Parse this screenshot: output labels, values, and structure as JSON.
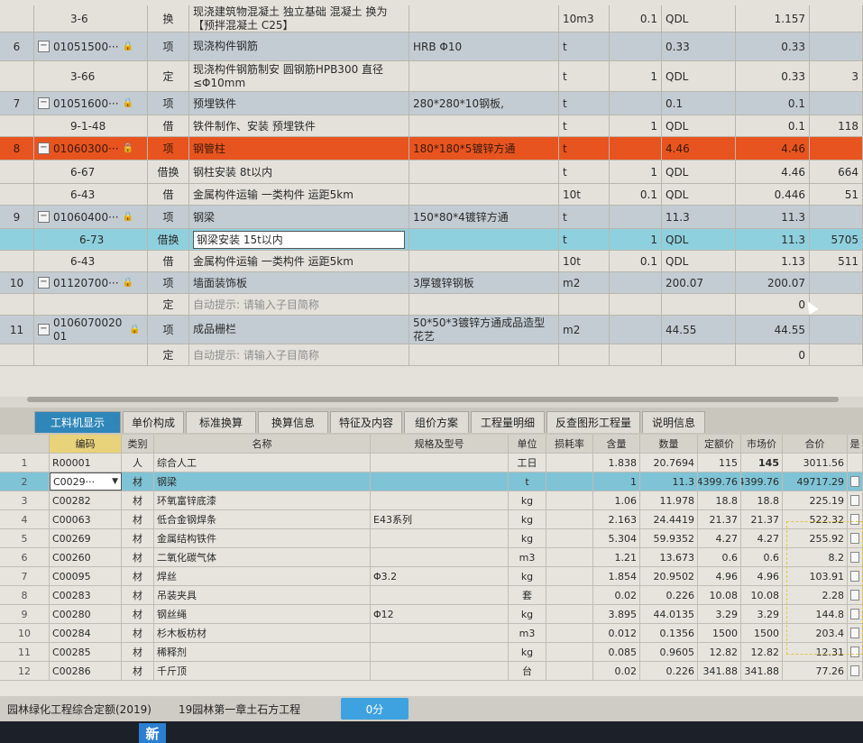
{
  "upper_grid": {
    "rows": [
      {
        "type": "sub",
        "num": "",
        "code": "3-6",
        "kind": "换",
        "name": "现浇建筑物混凝土 独立基础 混凝土 换为【预拌混凝土 C25】",
        "spec": "",
        "unit": "10m3",
        "qty_factor": "0.1",
        "qty": "QDL",
        "price": "",
        "total": "1.157",
        "extra": ""
      },
      {
        "type": "head",
        "num": "6",
        "code": "01051500···",
        "kind": "项",
        "name": "现浇构件钢筋",
        "spec": "HRB Φ10",
        "unit": "t",
        "qty_factor": "",
        "qty": "0.33",
        "price": "",
        "total": "0.33",
        "extra": ""
      },
      {
        "type": "sub",
        "num": "",
        "code": "3-66",
        "kind": "定",
        "name": "现浇构件钢筋制安 圆钢筋HPB300 直径≤Φ10mm",
        "spec": "",
        "unit": "t",
        "qty_factor": "1",
        "qty": "QDL",
        "price": "",
        "total": "0.33",
        "extra": "3"
      },
      {
        "type": "head",
        "num": "7",
        "code": "01051600···",
        "kind": "项",
        "name": "预埋铁件",
        "spec": "280*280*10钢板,",
        "unit": "t",
        "qty_factor": "",
        "qty": "0.1",
        "price": "",
        "total": "0.1",
        "extra": ""
      },
      {
        "type": "sub",
        "num": "",
        "code": "9-1-48",
        "kind": "借",
        "name": "铁件制作、安装 预埋铁件",
        "spec": "",
        "unit": "t",
        "qty_factor": "1",
        "qty": "QDL",
        "price": "",
        "total": "0.1",
        "extra": "118"
      },
      {
        "type": "sel",
        "num": "8",
        "code": "01060300···",
        "kind": "项",
        "name": "钢管柱",
        "spec": "180*180*5镀锌方通",
        "unit": "t",
        "qty_factor": "",
        "qty": "4.46",
        "price": "",
        "total": "4.46",
        "extra": ""
      },
      {
        "type": "sub",
        "num": "",
        "code": "6-67",
        "kind": "借换",
        "name": "钢柱安装 8t以内",
        "spec": "",
        "unit": "t",
        "qty_factor": "1",
        "qty": "QDL",
        "price": "",
        "total": "4.46",
        "extra": "664"
      },
      {
        "type": "sub",
        "num": "",
        "code": "6-43",
        "kind": "借",
        "name": "金属构件运输 一类构件 运距5km",
        "spec": "",
        "unit": "10t",
        "qty_factor": "0.1",
        "qty": "QDL",
        "price": "",
        "total": "0.446",
        "extra": "51"
      },
      {
        "type": "head",
        "num": "9",
        "code": "01060400···",
        "kind": "项",
        "name": "钢梁",
        "spec": "150*80*4镀锌方通",
        "unit": "t",
        "qty_factor": "",
        "qty": "11.3",
        "price": "",
        "total": "11.3",
        "extra": ""
      },
      {
        "type": "cur",
        "num": "",
        "code": "6-73",
        "kind": "借换",
        "name": "钢梁安装 15t以内",
        "spec": "",
        "unit": "t",
        "qty_factor": "1",
        "qty": "QDL",
        "price": "",
        "total": "11.3",
        "extra": "5705"
      },
      {
        "type": "sub",
        "num": "",
        "code": "6-43",
        "kind": "借",
        "name": "金属构件运输 一类构件 运距5km",
        "spec": "",
        "unit": "10t",
        "qty_factor": "0.1",
        "qty": "QDL",
        "price": "",
        "total": "1.13",
        "extra": "511"
      },
      {
        "type": "head",
        "num": "10",
        "code": "01120700···",
        "kind": "项",
        "name": "墙面装饰板",
        "spec": "3厚镀锌钢板",
        "unit": "m2",
        "qty_factor": "",
        "qty": "200.07",
        "price": "",
        "total": "200.07",
        "extra": ""
      },
      {
        "type": "sub",
        "num": "",
        "code": "",
        "kind": "定",
        "name": "自动提示: 请输入子目简称",
        "spec": "",
        "unit": "",
        "qty_factor": "",
        "qty": "",
        "price": "",
        "total": "0",
        "extra": "",
        "hint": true
      },
      {
        "type": "head",
        "num": "11",
        "code": "0106070020 01",
        "kind": "项",
        "name": "成品栅栏",
        "spec": "50*50*3镀锌方通成品造型花艺",
        "unit": "m2",
        "qty_factor": "",
        "qty": "44.55",
        "price": "",
        "total": "44.55",
        "extra": ""
      },
      {
        "type": "sub",
        "num": "",
        "code": "",
        "kind": "定",
        "name": "自动提示: 请输入子目简称",
        "spec": "",
        "unit": "",
        "qty_factor": "",
        "qty": "",
        "price": "",
        "total": "0",
        "extra": "",
        "hint": true
      }
    ]
  },
  "tabs": [
    "工料机显示",
    "单价构成",
    "标准换算",
    "换算信息",
    "特征及内容",
    "组价方案",
    "工程量明细",
    "反查图形工程量",
    "说明信息"
  ],
  "lower_grid": {
    "headers": [
      "",
      "编码",
      "类别",
      "名称",
      "规格及型号",
      "单位",
      "损耗率",
      "含量",
      "数量",
      "定额价",
      "市场价",
      "合价",
      "是"
    ],
    "rows": [
      {
        "n": "1",
        "code": "R00001",
        "cat": "人",
        "name": "综合人工",
        "spec": "",
        "unit": "工日",
        "loss": "",
        "content": "1.838",
        "qty": "20.7694",
        "quota": "115",
        "market": "145",
        "total": "3011.56"
      },
      {
        "n": "2",
        "code": "C0029···",
        "cat": "材",
        "name": "钢梁",
        "spec": "",
        "unit": "t",
        "loss": "",
        "content": "1",
        "qty": "11.3",
        "quota": "4399.76",
        "market": "4399.76",
        "total": "49717.29"
      },
      {
        "n": "3",
        "code": "C00282",
        "cat": "材",
        "name": "环氧富锌底漆",
        "spec": "",
        "unit": "kg",
        "loss": "",
        "content": "1.06",
        "qty": "11.978",
        "quota": "18.8",
        "market": "18.8",
        "total": "225.19"
      },
      {
        "n": "4",
        "code": "C00063",
        "cat": "材",
        "name": "低合金钢焊条",
        "spec": "E43系列",
        "unit": "kg",
        "loss": "",
        "content": "2.163",
        "qty": "24.4419",
        "quota": "21.37",
        "market": "21.37",
        "total": "522.32"
      },
      {
        "n": "5",
        "code": "C00269",
        "cat": "材",
        "name": "金属结构铁件",
        "spec": "",
        "unit": "kg",
        "loss": "",
        "content": "5.304",
        "qty": "59.9352",
        "quota": "4.27",
        "market": "4.27",
        "total": "255.92"
      },
      {
        "n": "6",
        "code": "C00260",
        "cat": "材",
        "name": "二氧化碳气体",
        "spec": "",
        "unit": "m3",
        "loss": "",
        "content": "1.21",
        "qty": "13.673",
        "quota": "0.6",
        "market": "0.6",
        "total": "8.2"
      },
      {
        "n": "7",
        "code": "C00095",
        "cat": "材",
        "name": "焊丝",
        "spec": "Φ3.2",
        "unit": "kg",
        "loss": "",
        "content": "1.854",
        "qty": "20.9502",
        "quota": "4.96",
        "market": "4.96",
        "total": "103.91"
      },
      {
        "n": "8",
        "code": "C00283",
        "cat": "材",
        "name": "吊装夹具",
        "spec": "",
        "unit": "套",
        "loss": "",
        "content": "0.02",
        "qty": "0.226",
        "quota": "10.08",
        "market": "10.08",
        "total": "2.28"
      },
      {
        "n": "9",
        "code": "C00280",
        "cat": "材",
        "name": "钢丝绳",
        "spec": "Φ12",
        "unit": "kg",
        "loss": "",
        "content": "3.895",
        "qty": "44.0135",
        "quota": "3.29",
        "market": "3.29",
        "total": "144.8"
      },
      {
        "n": "10",
        "code": "C00284",
        "cat": "材",
        "name": "杉木板枋材",
        "spec": "",
        "unit": "m3",
        "loss": "",
        "content": "0.012",
        "qty": "0.1356",
        "quota": "1500",
        "market": "1500",
        "total": "203.4"
      },
      {
        "n": "11",
        "code": "C00285",
        "cat": "材",
        "name": "稀释剂",
        "spec": "",
        "unit": "kg",
        "loss": "",
        "content": "0.085",
        "qty": "0.9605",
        "quota": "12.82",
        "market": "12.82",
        "total": "12.31"
      },
      {
        "n": "12",
        "code": "C00286",
        "cat": "材",
        "name": "千斤顶",
        "spec": "",
        "unit": "台",
        "loss": "",
        "content": "0.02",
        "qty": "0.226",
        "quota": "341.88",
        "market": "341.88",
        "total": "77.26"
      }
    ]
  },
  "bottom_tabs": {
    "items": [
      "园林绿化工程综合定额(2019)",
      "19园林第一章土石方工程"
    ],
    "badge": "0分"
  },
  "taskbar": {
    "logo": "新"
  },
  "colors": {
    "selected_row": "#e8541f",
    "current_row": "#8fd0de",
    "active_tab": "#2f86b8",
    "header_row": "#c3ccd3"
  },
  "icons": {
    "expander": "minus-box-icon",
    "lock": "lock-icon",
    "checkbox": "checkbox-icon",
    "dropdown": "chevron-down-icon"
  }
}
